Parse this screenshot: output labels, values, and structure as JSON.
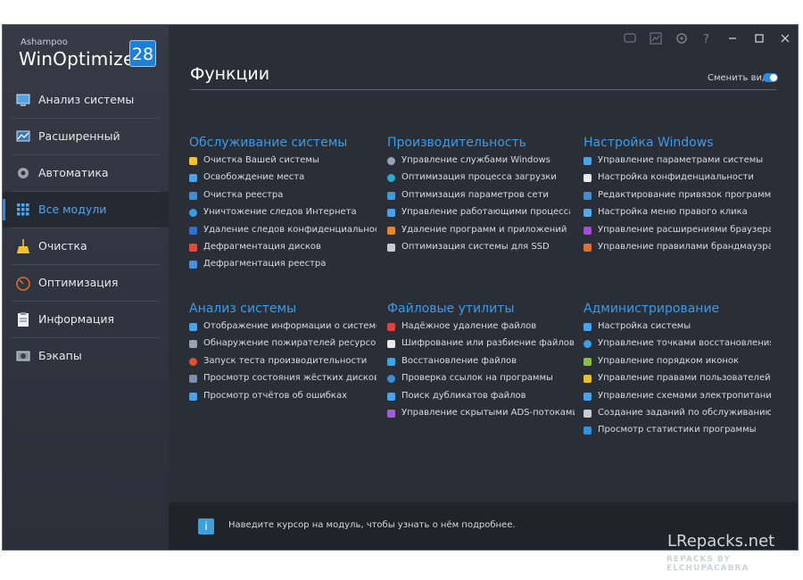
{
  "app": {
    "logo_sub": "Ashampoo",
    "logo_main": "WinOptimizer",
    "logo_version": "28"
  },
  "sidebar": {
    "items": [
      {
        "label": "Анализ системы",
        "icon": "monitor-icon"
      },
      {
        "label": "Расширенный",
        "icon": "chart-icon"
      },
      {
        "label": "Автоматика",
        "icon": "gear-icon"
      },
      {
        "label": "Все модули",
        "icon": "grid-icon",
        "active": true
      },
      {
        "label": "Очистка",
        "icon": "broom-icon"
      },
      {
        "label": "Оптимизация",
        "icon": "speedometer-icon"
      },
      {
        "label": "Информация",
        "icon": "clipboard-icon"
      },
      {
        "label": "Бэкапы",
        "icon": "backup-icon"
      }
    ]
  },
  "header": {
    "title": "Функции",
    "toggle_label": "Сменить вид",
    "toggle_on": true
  },
  "sections": [
    {
      "title": "Обслуживание системы",
      "items": [
        "Очистка Вашей системы",
        "Освобождение места",
        "Очистка реестра",
        "Уничтожение следов Интернета",
        "Удаление следов конфиденциальности",
        "Дефрагментация дисков",
        "Дефрагментация реестра"
      ]
    },
    {
      "title": "Производительность",
      "items": [
        "Управление службами Windows",
        "Оптимизация процесса загрузки",
        "Оптимизация параметров сети",
        "Управление работающими процессами",
        "Удаление программ и приложений",
        "Оптимизация системы для SSD"
      ]
    },
    {
      "title": "Настройка Windows",
      "items": [
        "Управление параметрами системы",
        "Настройка конфиденциальности",
        "Редактирование привязок программ",
        "Настройка меню правого клика",
        "Управление расширениями браузера",
        "Управление правилами брандмауэра"
      ]
    },
    {
      "title": "Анализ системы",
      "items": [
        "Отображение информации о системе",
        "Обнаружение пожирателей ресурсов",
        "Запуск теста производительности",
        "Просмотр состояния жёстких дисков",
        "Просмотр отчётов об ошибках"
      ]
    },
    {
      "title": "Файловые утилиты",
      "items": [
        "Надёжное удаление файлов",
        "Шифрование или разбиение файлов",
        "Восстановление файлов",
        "Проверка ссылок на программы",
        "Поиск дубликатов файлов",
        "Управление скрытыми ADS-потоками"
      ]
    },
    {
      "title": "Администрирование",
      "items": [
        "Настройка системы",
        "Управление точками восстановления",
        "Управление порядком иконок",
        "Управление правами пользователей",
        "Управление схемами электропитания",
        "Создание заданий по обслуживанию",
        "Просмотр статистики программы"
      ]
    }
  ],
  "footer": {
    "hint": "Наведите курсор на модуль, чтобы узнать о нём подробнее."
  },
  "watermark": {
    "line1": "LRepacks.net",
    "line2": "REPACKS BY ELCHUPACABRA"
  },
  "colors": {
    "accent": "#2a8be0",
    "section_title": "#3c9be9",
    "background": "#2a2e37"
  }
}
